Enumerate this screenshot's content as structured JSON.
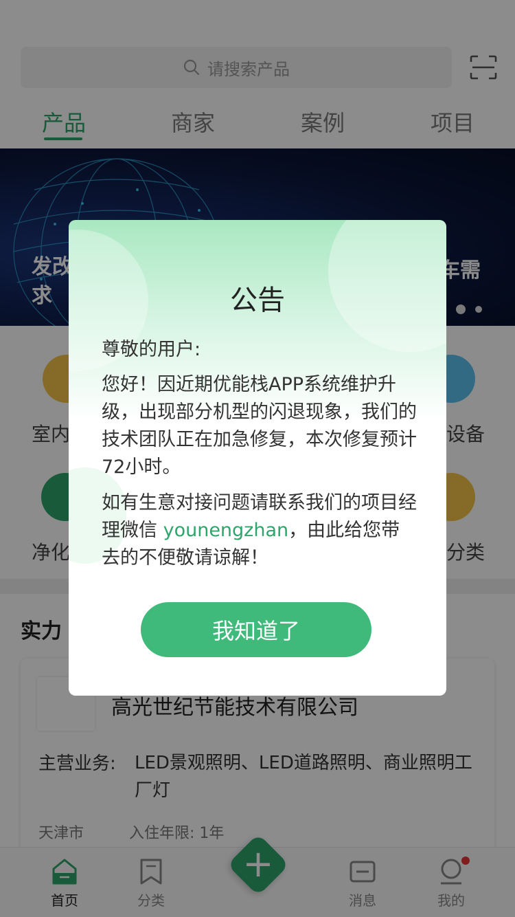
{
  "search": {
    "placeholder": "请搜索产品"
  },
  "tabs": [
    {
      "label": "产品",
      "active": true
    },
    {
      "label": "商家",
      "active": false
    },
    {
      "label": "案例",
      "active": false
    },
    {
      "label": "项目",
      "active": false
    }
  ],
  "banner": {
    "text_left": "发改\n求",
    "text_right": "车需"
  },
  "categories": [
    {
      "label": "室内",
      "icon": "umbrella-icon",
      "color": "#f3c348"
    },
    {
      "label": "设备",
      "icon": "device-icon",
      "color": "#5ec2ef"
    },
    {
      "label": "净化",
      "icon": "leaf-icon",
      "color": "#2ea56a"
    },
    {
      "label": "分类",
      "icon": "grid-icon",
      "color": "#f3c348"
    }
  ],
  "section": {
    "title": "实力"
  },
  "company_card": {
    "name": "高光世纪节能技术有限公司",
    "business_label": "主营业务:",
    "business": "LED景观照明、LED道路照明、商业照明工厂灯",
    "city": "天津市",
    "years": "入住年限: 1年"
  },
  "bottom_nav": [
    {
      "label": "首页",
      "icon": "home-icon",
      "active": true
    },
    {
      "label": "分类",
      "icon": "bookmark-icon",
      "active": false
    },
    {
      "label": "消息",
      "icon": "message-icon",
      "active": false
    },
    {
      "label": "我的",
      "icon": "profile-icon",
      "active": false
    }
  ],
  "fab": {
    "icon": "plus-icon"
  },
  "notice": {
    "title": "公告",
    "greeting": "尊敬的用户:",
    "para1": "您好！因近期优能栈APP系统维护升级，出现部分机型的闪退现象，我们的技术团队正在加急修复，本次修复预计72小时。",
    "para2_before": "如有生意对接问题请联系我们的项目经理微信 ",
    "wechat": "younengzhan",
    "para2_after": "，由此给您带去的不便敬请谅解！",
    "button": "我知道了"
  },
  "colors": {
    "accent": "#2ea56a",
    "button": "#3fba7b",
    "badge": "#e53935"
  }
}
